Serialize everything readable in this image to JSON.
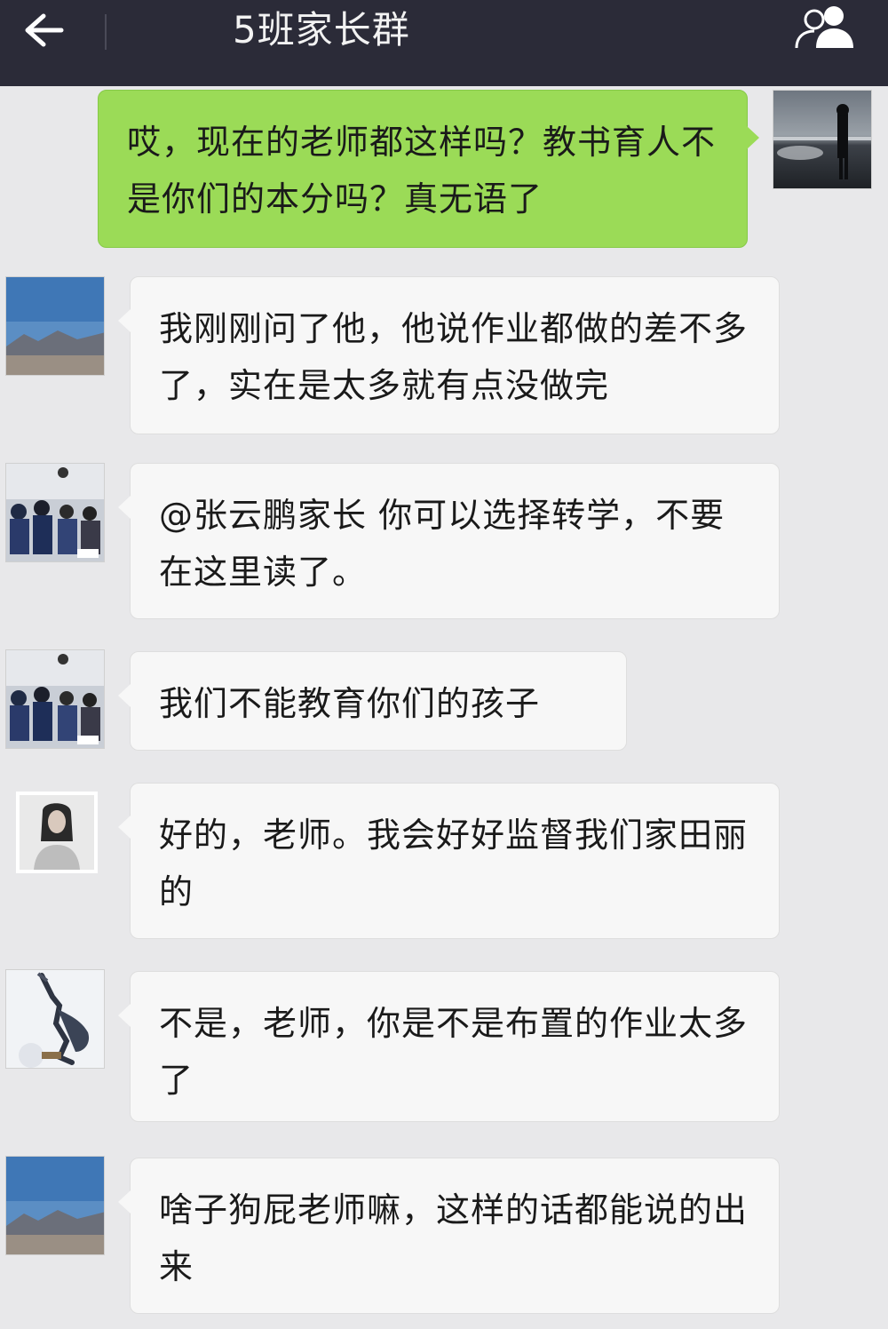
{
  "header": {
    "title": "5班家长群",
    "back_icon": "back-arrow-icon",
    "members_icon": "group-members-icon"
  },
  "messages": [
    {
      "sender": "self",
      "avatar": "avatar-lake-silhouette",
      "text": "哎，现在的老师都这样吗？教书育人不是你们的本分吗？真无语了"
    },
    {
      "sender": "other",
      "avatar": "avatar-blue-sky-mountains",
      "text": "我刚刚问了他，他说作业都做的差不多了，实在是太多就有点没做完"
    },
    {
      "sender": "other",
      "avatar": "avatar-classroom-group",
      "text": "@张云鹏家长 你可以选择转学，不要在这里读了。"
    },
    {
      "sender": "other",
      "avatar": "avatar-classroom-group",
      "text": "我们不能教育你们的孩子"
    },
    {
      "sender": "other",
      "avatar": "avatar-woman-portrait",
      "text": "好的，老师。我会好好监督我们家田丽的"
    },
    {
      "sender": "other",
      "avatar": "avatar-dancer-figure",
      "text": "不是，老师，你是不是布置的作业太多了"
    },
    {
      "sender": "other",
      "avatar": "avatar-blue-sky-mountains",
      "text": "啥子狗屁老师嘛，这样的话都能说的出来"
    }
  ],
  "colors": {
    "header_bg": "#2b2b38",
    "outgoing_bubble": "#9bdb57",
    "incoming_bubble": "#f7f7f7",
    "chat_bg": "#e8e8ea"
  }
}
